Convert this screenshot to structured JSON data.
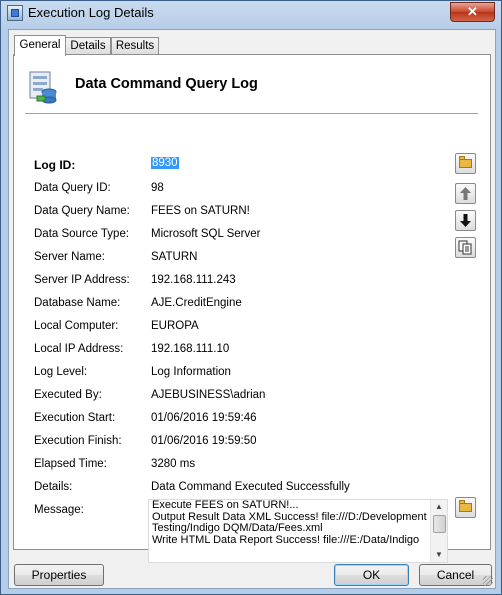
{
  "window": {
    "title": "Execution Log Details",
    "close_label": "✕"
  },
  "tabs": [
    {
      "label": "General",
      "active": true
    },
    {
      "label": "Details",
      "active": false
    },
    {
      "label": "Results",
      "active": false
    }
  ],
  "header": {
    "title": "Data Command Query Log",
    "icon": "database-log-icon"
  },
  "fields": {
    "log_id": {
      "label": "Log ID:",
      "value": "8930"
    },
    "data_query_id": {
      "label": "Data Query ID:",
      "value": "98"
    },
    "data_query_name": {
      "label": "Data Query Name:",
      "value": "FEES on SATURN!"
    },
    "data_source_type": {
      "label": "Data Source Type:",
      "value": "Microsoft SQL Server"
    },
    "server_name": {
      "label": "Server Name:",
      "value": "SATURN"
    },
    "server_ip": {
      "label": "Server IP Address:",
      "value": "192.168.111.243"
    },
    "database_name": {
      "label": "Database Name:",
      "value": "AJE.CreditEngine"
    },
    "local_computer": {
      "label": "Local Computer:",
      "value": "EUROPA"
    },
    "local_ip": {
      "label": "Local IP Address:",
      "value": "192.168.111.10"
    },
    "log_level": {
      "label": "Log Level:",
      "value": "Log Information"
    },
    "executed_by": {
      "label": "Executed By:",
      "value": "AJEBUSINESS\\adrian"
    },
    "execution_start": {
      "label": "Execution Start:",
      "value": "01/06/2016 19:59:46"
    },
    "execution_finish": {
      "label": "Execution Finish:",
      "value": "01/06/2016 19:59:50"
    },
    "elapsed_time": {
      "label": "Elapsed Time:",
      "value": "3280 ms"
    },
    "details": {
      "label": "Details:",
      "value": "Data Command Executed Successfully"
    },
    "message": {
      "label": "Message:",
      "lines": [
        "Execute FEES on SATURN!...",
        "Output Result Data XML Success! file:///D:/Development",
        "Testing/Indigo DQM/Data/Fees.xml",
        "Write HTML Data Report Success! file:///E:/Data/Indigo"
      ]
    }
  },
  "tools": {
    "open_folder_icon": "folder-open-icon",
    "up_icon": "arrow-up-icon",
    "down_icon": "arrow-down-icon",
    "copy_icon": "copy-icon",
    "message_folder_icon": "folder-open-icon"
  },
  "footer": {
    "properties_label": "Properties",
    "ok_label": "OK",
    "cancel_label": "Cancel"
  }
}
